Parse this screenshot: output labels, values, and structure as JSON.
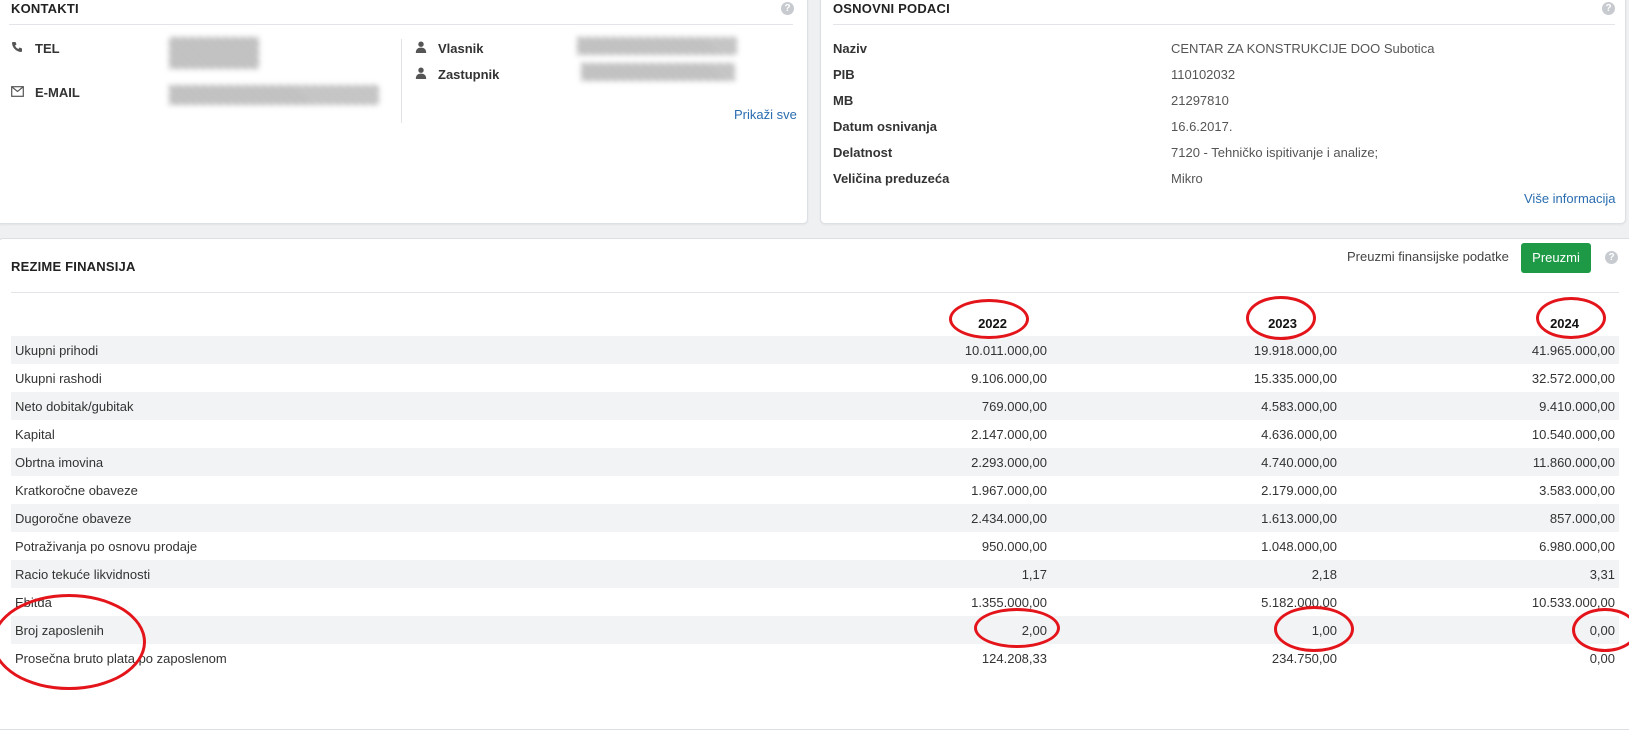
{
  "kontakti": {
    "title": "KONTAKTI",
    "tel_label": "TEL",
    "tel_value": "",
    "email_label": "E-MAIL",
    "email_value": "",
    "vlasnik_label": "Vlasnik",
    "vlasnik_value": "",
    "zastupnik_label": "Zastupnik",
    "zastupnik_value": "",
    "show_all": "Prikaži sve"
  },
  "osnovni": {
    "title": "OSNOVNI PODACI",
    "rows": [
      {
        "label": "Naziv",
        "value": "CENTAR ZA KONSTRUKCIJE DOO Subotica"
      },
      {
        "label": "PIB",
        "value": "110102032"
      },
      {
        "label": "MB",
        "value": "21297810"
      },
      {
        "label": "Datum osnivanja",
        "value": "16.6.2017."
      },
      {
        "label": "Delatnost",
        "value": "7120 - Tehničko ispitivanje i analize;"
      },
      {
        "label": "Veličina preduzeća",
        "value": "Mikro"
      }
    ],
    "more_info": "Više informacija"
  },
  "rezime": {
    "title": "REZIME FINANSIJA",
    "download_text": "Preuzmi finansijske podatke",
    "download_button": "Preuzmi",
    "years": [
      "2022",
      "2023",
      "2024"
    ],
    "rows": [
      {
        "label": "Ukupni prihodi",
        "values": [
          "10.011.000,00",
          "19.918.000,00",
          "41.965.000,00"
        ]
      },
      {
        "label": "Ukupni rashodi",
        "values": [
          "9.106.000,00",
          "15.335.000,00",
          "32.572.000,00"
        ]
      },
      {
        "label": "Neto dobitak/gubitak",
        "values": [
          "769.000,00",
          "4.583.000,00",
          "9.410.000,00"
        ]
      },
      {
        "label": "Kapital",
        "values": [
          "2.147.000,00",
          "4.636.000,00",
          "10.540.000,00"
        ]
      },
      {
        "label": "Obrtna imovina",
        "values": [
          "2.293.000,00",
          "4.740.000,00",
          "11.860.000,00"
        ]
      },
      {
        "label": "Kratkoročne obaveze",
        "values": [
          "1.967.000,00",
          "2.179.000,00",
          "3.583.000,00"
        ]
      },
      {
        "label": "Dugoročne obaveze",
        "values": [
          "2.434.000,00",
          "1.613.000,00",
          "857.000,00"
        ]
      },
      {
        "label": "Potraživanja po osnovu prodaje",
        "values": [
          "950.000,00",
          "1.048.000,00",
          "6.980.000,00"
        ]
      },
      {
        "label": "Racio tekuće likvidnosti",
        "values": [
          "1,17",
          "2,18",
          "3,31"
        ]
      },
      {
        "label": "Ebitda",
        "values": [
          "1.355.000,00",
          "5.182.000,00",
          "10.533.000,00"
        ]
      },
      {
        "label": "Broj zaposlenih",
        "values": [
          "2,00",
          "1,00",
          "0,00"
        ]
      },
      {
        "label": "Prosečna bruto plata po zaposlenom",
        "values": [
          "124.208,33",
          "234.750,00",
          "0,00"
        ]
      }
    ]
  },
  "annotation_color": "#e4141b"
}
